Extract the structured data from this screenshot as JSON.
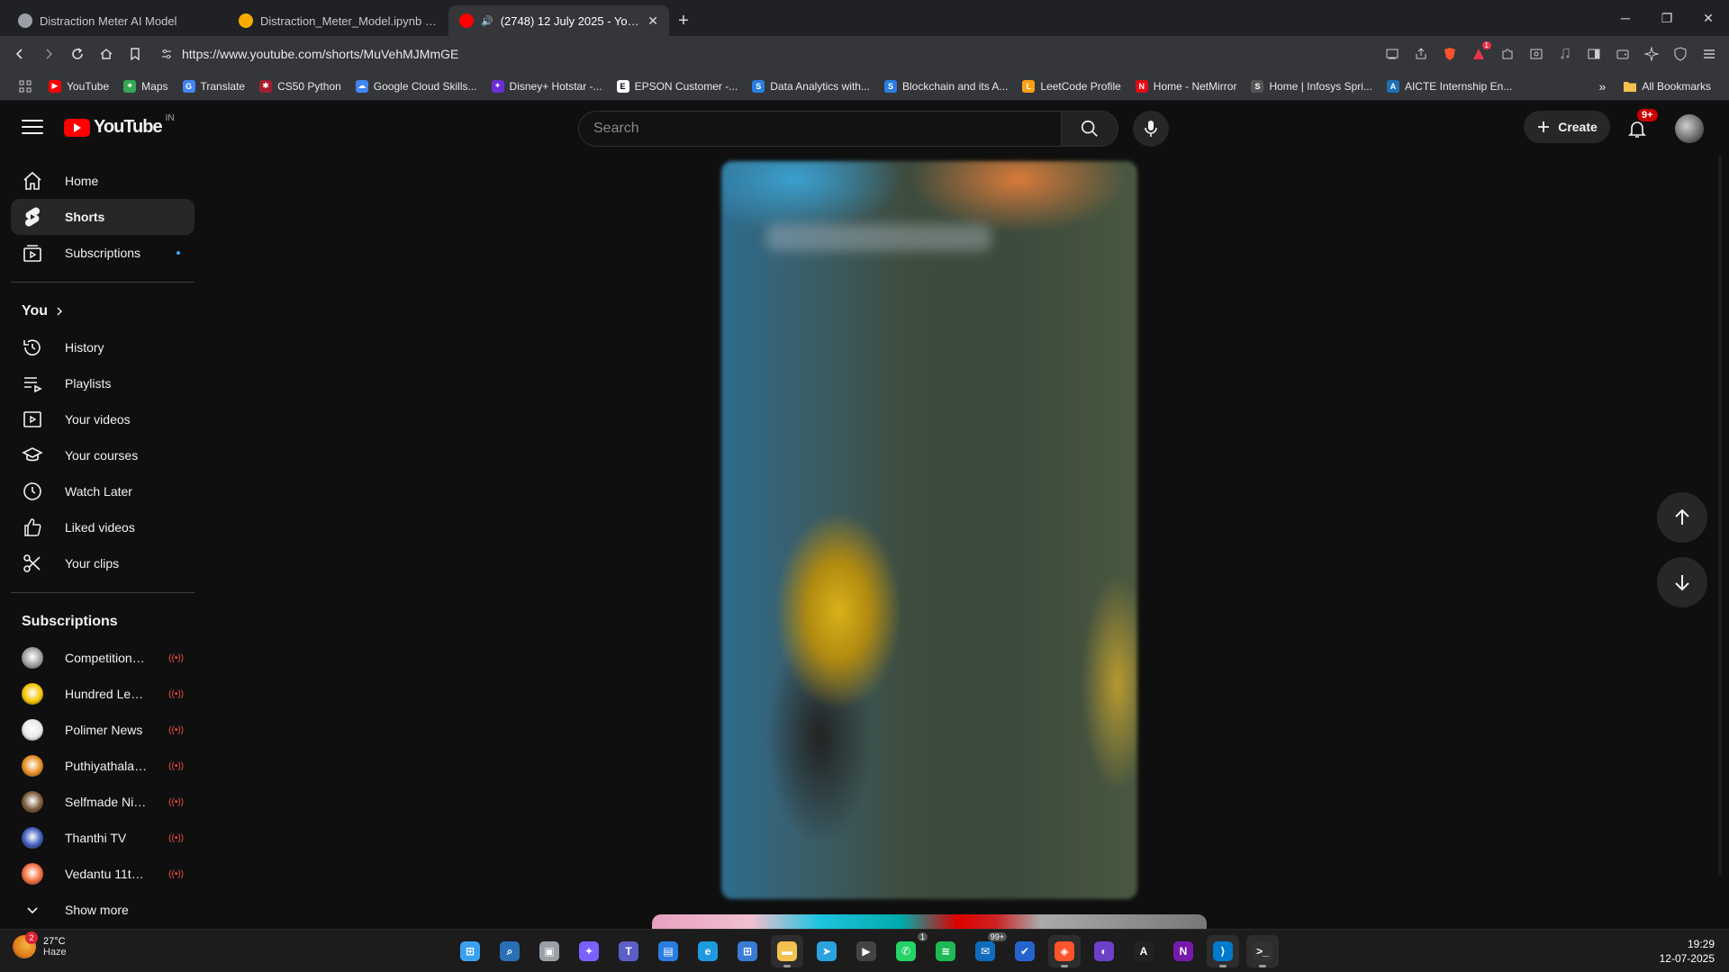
{
  "browser": {
    "tabs": [
      {
        "title": "Distraction Meter AI Model",
        "active": false,
        "icon": "globe-icon"
      },
      {
        "title": "Distraction_Meter_Model.ipynb - Col…",
        "active": false,
        "icon": "colab-icon"
      },
      {
        "title": "(2748) 12 July 2025 - YouTube",
        "active": true,
        "icon": "youtube-icon"
      }
    ],
    "new_tab": "+",
    "window_controls": {
      "minimize": "─",
      "restore": "❐",
      "close": "✕"
    },
    "url": "https://www.youtube.com/shorts/MuVehMJMmGE",
    "extension_badge": "1",
    "bookmarks": [
      {
        "label": "YouTube",
        "color": "#ff0000",
        "glyph": "▶"
      },
      {
        "label": "Maps",
        "color": "#34a853",
        "glyph": "⌖"
      },
      {
        "label": "Translate",
        "color": "#4285f4",
        "glyph": "G"
      },
      {
        "label": "CS50 Python",
        "color": "#a51c30",
        "glyph": "✱"
      },
      {
        "label": "Google Cloud Skills...",
        "color": "#4285f4",
        "glyph": "☁"
      },
      {
        "label": "Disney+ Hotstar -...",
        "color": "#6b2ed6",
        "glyph": "✦"
      },
      {
        "label": "EPSON Customer -...",
        "color": "#ffffff",
        "glyph": "E"
      },
      {
        "label": "Data Analytics with...",
        "color": "#2a7de1",
        "glyph": "S"
      },
      {
        "label": "Blockchain and its A...",
        "color": "#2a7de1",
        "glyph": "S"
      },
      {
        "label": "LeetCode Profile",
        "color": "#ffa116",
        "glyph": "L"
      },
      {
        "label": "Home - NetMirror",
        "color": "#e50914",
        "glyph": "N"
      },
      {
        "label": "Home | Infosys Spri...",
        "color": "#555555",
        "glyph": "S"
      },
      {
        "label": "AICTE Internship En...",
        "color": "#1f6fb5",
        "glyph": "A"
      }
    ],
    "bookmarks_more": "»",
    "all_bookmarks": "All Bookmarks"
  },
  "youtube": {
    "logo_text": "YouTube",
    "country_code": "IN",
    "search_placeholder": "Search",
    "create_label": "Create",
    "notifications_badge": "9+",
    "sidebar": {
      "main": [
        {
          "label": "Home",
          "icon": "home-icon",
          "active": false
        },
        {
          "label": "Shorts",
          "icon": "shorts-icon",
          "active": true
        },
        {
          "label": "Subscriptions",
          "icon": "subscriptions-icon",
          "active": false
        }
      ],
      "you_heading": "You",
      "you": [
        {
          "label": "History",
          "icon": "history-icon"
        },
        {
          "label": "Playlists",
          "icon": "playlists-icon"
        },
        {
          "label": "Your videos",
          "icon": "your-videos-icon"
        },
        {
          "label": "Your courses",
          "icon": "courses-icon"
        },
        {
          "label": "Watch Later",
          "icon": "watch-later-icon"
        },
        {
          "label": "Liked videos",
          "icon": "like-icon"
        },
        {
          "label": "Your clips",
          "icon": "clips-icon"
        }
      ],
      "subscriptions_heading": "Subscriptions",
      "subscriptions": [
        {
          "name": "Competition Wall...",
          "color": "#9e9e9e"
        },
        {
          "name": "Hundred Learnin...",
          "color": "#f5c400"
        },
        {
          "name": "Polimer News",
          "color": "#e8e8e8"
        },
        {
          "name": "Puthiyathalaimur...",
          "color": "#e58b1c"
        },
        {
          "name": "Selfmade Ninja ...",
          "color": "#7a5a3a"
        },
        {
          "name": "Thanthi TV",
          "color": "#3a5bb8"
        },
        {
          "name": "Vedantu 11th 12...",
          "color": "#f26b3a"
        }
      ],
      "live_indicator": "((•))",
      "show_more": "Show more"
    }
  },
  "taskbar": {
    "weather_temp": "27°C",
    "weather_desc": "Haze",
    "weather_badge": "2",
    "time": "19:29",
    "date": "12-07-2025",
    "apps": [
      {
        "name": "windows-start-icon",
        "color": "#3aa0f0",
        "glyph": "⊞",
        "active": false
      },
      {
        "name": "search-icon",
        "color": "#2a6fb5",
        "glyph": "⌕",
        "active": false
      },
      {
        "name": "task-view-icon",
        "color": "#9aa0a6",
        "glyph": "▣",
        "active": false
      },
      {
        "name": "copilot-icon",
        "color": "#7b61ff",
        "glyph": "✦",
        "active": false
      },
      {
        "name": "teams-icon",
        "color": "#5b5fc7",
        "glyph": "T",
        "active": false
      },
      {
        "name": "widgets-icon",
        "color": "#2a7de1",
        "glyph": "▤",
        "active": false
      },
      {
        "name": "edge-icon",
        "color": "#1e9be0",
        "glyph": "e",
        "active": false
      },
      {
        "name": "store-icon",
        "color": "#3a7bd5",
        "glyph": "⊞",
        "active": false
      },
      {
        "name": "file-explorer-icon",
        "color": "#f2c14e",
        "glyph": "▬",
        "active": true
      },
      {
        "name": "telegram-icon",
        "color": "#2aa3df",
        "glyph": "➤",
        "active": false
      },
      {
        "name": "media-player-icon",
        "color": "#444444",
        "glyph": "▶",
        "active": false
      },
      {
        "name": "whatsapp-icon",
        "color": "#25d366",
        "glyph": "✆",
        "active": false,
        "count": "1"
      },
      {
        "name": "spotify-icon",
        "color": "#1db954",
        "glyph": "≋",
        "active": false
      },
      {
        "name": "mail-icon",
        "color": "#0f6cbd",
        "glyph": "✉",
        "active": false,
        "count": "99+"
      },
      {
        "name": "todo-icon",
        "color": "#2564cf",
        "glyph": "✔",
        "active": false
      },
      {
        "name": "brave-icon",
        "color": "#fb542b",
        "glyph": "◈",
        "active": true
      },
      {
        "name": "github-desktop-icon",
        "color": "#6e40c9",
        "glyph": "◐",
        "active": false
      },
      {
        "name": "affinity-icon",
        "color": "#222222",
        "glyph": "A",
        "active": false
      },
      {
        "name": "onenote-icon",
        "color": "#7719aa",
        "glyph": "N",
        "active": false
      },
      {
        "name": "vscode-icon",
        "color": "#007acc",
        "glyph": "⟩",
        "active": true
      },
      {
        "name": "terminal-icon",
        "color": "#333333",
        "glyph": ">_",
        "active": true
      }
    ]
  }
}
